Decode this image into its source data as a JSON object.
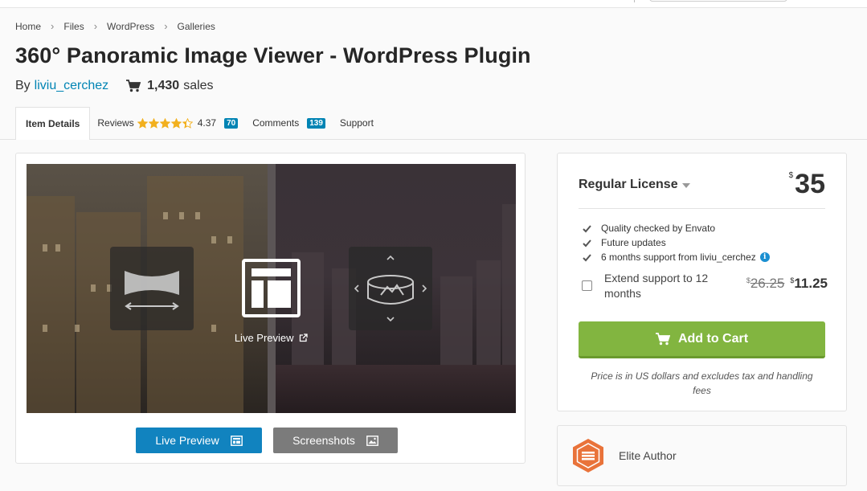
{
  "breadcrumb": [
    "Home",
    "Files",
    "WordPress",
    "Galleries"
  ],
  "page_title": "360° Panoramic Image Viewer - WordPress Plugin",
  "byline": {
    "by": "By",
    "author": "liviu_cerchez",
    "sales_count": "1,430",
    "sales_word": "sales"
  },
  "tabs": {
    "item_details": "Item Details",
    "reviews": "Reviews",
    "rating": "4.37",
    "rating_stars": 4.37,
    "reviews_count": "70",
    "comments": "Comments",
    "comments_count": "139",
    "support": "Support"
  },
  "preview": {
    "live_preview_label": "Live Preview",
    "live_preview_button": "Live Preview",
    "screenshots_button": "Screenshots"
  },
  "license": {
    "title": "Regular License",
    "currency": "$",
    "price": "35",
    "features": [
      "Quality checked by Envato",
      "Future updates",
      "6 months support from liviu_cerchez"
    ],
    "extend_label": "Extend support to 12 months",
    "old_price": "26.25",
    "new_price": "11.25",
    "add_to_cart": "Add to Cart",
    "price_note": "Price is in US dollars and excludes tax and handling fees"
  },
  "badge": {
    "label": "Elite Author"
  },
  "colors": {
    "link": "#0084b4",
    "star": "#f2b01e",
    "cart_green": "#82b540",
    "elite_orange": "#e9733a",
    "button_blue": "#1183bf"
  }
}
